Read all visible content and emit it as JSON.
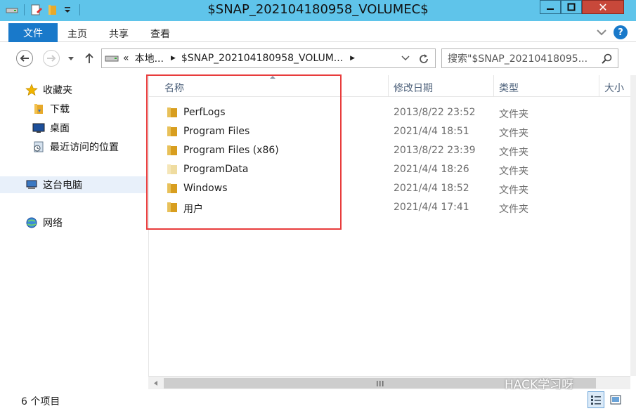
{
  "window": {
    "title": "$SNAP_202104180958_VOLUMEC$",
    "controls": {
      "close": "✕"
    }
  },
  "ribbon": {
    "tabs": [
      "文件",
      "主页",
      "共享",
      "查看"
    ],
    "help": "?"
  },
  "navigation": {
    "address": {
      "prefix": "«",
      "crumb1": "本地...",
      "crumb2": "$SNAP_202104180958_VOLUM...",
      "sep": "▶"
    },
    "search_placeholder": "搜索\"$SNAP_20210418095..."
  },
  "nav_pane": {
    "favorites": "收藏夹",
    "downloads": "下载",
    "desktop": "桌面",
    "recent": "最近访问的位置",
    "this_pc": "这台电脑",
    "network": "网络"
  },
  "columns": {
    "name": "名称",
    "date": "修改日期",
    "type": "类型",
    "size": "大小"
  },
  "files": [
    {
      "name": "PerfLogs",
      "date": "2013/8/22 23:52",
      "type": "文件夹",
      "light": false
    },
    {
      "name": "Program Files",
      "date": "2021/4/4 18:51",
      "type": "文件夹",
      "light": false
    },
    {
      "name": "Program Files (x86)",
      "date": "2013/8/22 23:39",
      "type": "文件夹",
      "light": false
    },
    {
      "name": "ProgramData",
      "date": "2021/4/4 18:26",
      "type": "文件夹",
      "light": true
    },
    {
      "name": "Windows",
      "date": "2021/4/4 18:52",
      "type": "文件夹",
      "light": false
    },
    {
      "name": "用户",
      "date": "2021/4/4 17:41",
      "type": "文件夹",
      "light": false
    }
  ],
  "status": {
    "count": "6 个项目"
  },
  "watermark": "HACK学习呀",
  "colors": {
    "titlebar": "#5fc4ea",
    "file_tab": "#1979ca",
    "highlight_box": "#e83c3c",
    "folder": "#e8c15a"
  }
}
